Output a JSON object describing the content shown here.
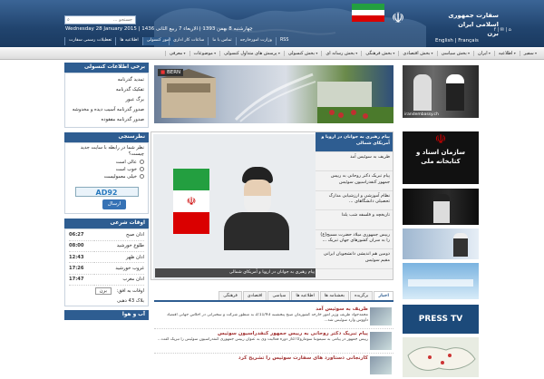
{
  "header": {
    "embassy_title_line1": "سفارت جمهوری اسلامی ایران",
    "embassy_title_line2": "برن",
    "date": "Wednesday 28 January 2015 | چهارشنبه 8 بهمن 1393 | الاربعاء 7 ربیع الثانی 1436",
    "search_placeholder": "جستجو ...",
    "lang_en": "English",
    "lang_fr": "Français",
    "social": "f | ✉ | ⌂",
    "top_links_left": [
      "امور کنسولی",
      "اطلاعیه ها",
      "تعطیلات رسمی سفارت"
    ],
    "top_links_right": [
      "RSS",
      "وزارت امورخارجه",
      "تماس با ما",
      "ساعات کار اداری"
    ],
    "colors": {
      "header_bg": "#21446e",
      "accent": "#2e5d91",
      "news_title": "#a23232"
    }
  },
  "nav": {
    "items": [
      "سفیر",
      "اطلاعیه",
      "ایران",
      "بخش سیاسی",
      "بخش اقتصادی",
      "بخش فرهنگی",
      "بخش رسانه ای",
      "بخش کنسولی",
      "پرسش های متداول کنسولی",
      "موضوعات",
      "معرفی"
    ]
  },
  "sidebar": {
    "consular": {
      "title": "برخی اطلاعات کنسولی",
      "items": [
        "تمدید گذرنامه",
        "تفکیک گذرنامه",
        "برگ عبور",
        "صدور گذرنامه آسیب دیده و مخدوشه",
        "صدور گذرنامه مفقوده"
      ]
    },
    "poll": {
      "title": "نظرسنجی",
      "question": "نظر شما در رابطه با سایت جدید چیست؟",
      "options": [
        "عالی است",
        "خوب است",
        "خیلی معمولیست"
      ],
      "ad_label": "AD92",
      "submit": "ارسال"
    },
    "prayer": {
      "title": "اوقات شرعی",
      "rows": [
        {
          "label": "اذان صبح",
          "value": "06:27"
        },
        {
          "label": "طلوع خورشید",
          "value": "08:00"
        },
        {
          "label": "اذان ظهر",
          "value": "12:43"
        },
        {
          "label": "غروب خورشید",
          "value": "17:26"
        },
        {
          "label": "اذان مغرب",
          "value": "17:47"
        }
      ],
      "city_label": "اوقات به افق:",
      "city_value": "برن",
      "footer": "بلاک 43 ذهبی"
    },
    "bottom_title": "آب و هوا"
  },
  "banner": {
    "tag": "BERN"
  },
  "slider": {
    "caption": "پیام رهبری به جوانان در اروپا و آمریکای شمالی",
    "titles": [
      "پیام رهبری به جوانان در اروپا و آمریکای شمالی",
      "ظریف به سوئیس آمد",
      "پیام تبریک دکتر روحانی به رییس جمهور کنفدراسیون سوئیس",
      "نظام آموزشی و ارزشیابی مدارک تحصیلی دانشگاهای ...",
      "تاریخچه و فلسفه شب یلدا",
      "رییس جمهوری میلاد حضرت مسیح(ع) را به سران کشورهای جهان تبریک ...",
      "دومین هم اندیشی دانشجویان ایرانی مقیم سوئیس"
    ]
  },
  "tabs": {
    "items": [
      "اخبار",
      "برگزیده",
      "بخشنامه ها",
      "اطلاعیه ها",
      "سیاسی",
      "اقتصادی",
      "فرهنگی"
    ]
  },
  "news": [
    {
      "title": "ظریف به سوئیس آمد",
      "summary": "محمدجواد ظریف وزیر امور خارجه کشورمان صبح پنجشنبه 2/11/93 به منظور شرکت و سخنرانی در اجلاس جهانی اقتصاد داووس وارد سوئیس شد..."
    },
    {
      "title": "پیام تبریک دکتر روحانی به رییس جمهور کنفدراسیون سوئیس",
      "summary": "رییس جمهور در پیامی به سیموتنا سوماروگا آغاز دوره فعالیت وی به عنوان رییس جمهوری کنفدراسیون سوئیس را تبریک گفت..."
    },
    {
      "title": "کارنجانی دستاورد های سفارت سوئیس را تشریح کرد",
      "summary": ""
    }
  ],
  "right": {
    "leader_site": "irandembassy.ch",
    "archive_line1": "سازمان اسناد و",
    "archive_line2": "کتابخانه ملی",
    "press_tv": "PRESS TV"
  }
}
